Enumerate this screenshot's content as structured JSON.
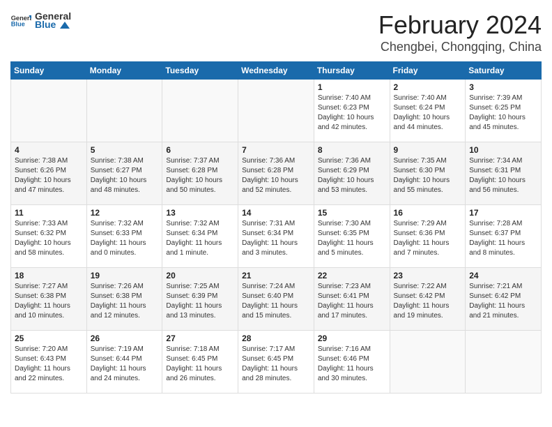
{
  "logo": {
    "general": "General",
    "blue": "Blue"
  },
  "title": "February 2024",
  "location": "Chengbei, Chongqing, China",
  "days_of_week": [
    "Sunday",
    "Monday",
    "Tuesday",
    "Wednesday",
    "Thursday",
    "Friday",
    "Saturday"
  ],
  "weeks": [
    [
      {
        "day": "",
        "info": ""
      },
      {
        "day": "",
        "info": ""
      },
      {
        "day": "",
        "info": ""
      },
      {
        "day": "",
        "info": ""
      },
      {
        "day": "1",
        "info": "Sunrise: 7:40 AM\nSunset: 6:23 PM\nDaylight: 10 hours and 42 minutes."
      },
      {
        "day": "2",
        "info": "Sunrise: 7:40 AM\nSunset: 6:24 PM\nDaylight: 10 hours and 44 minutes."
      },
      {
        "day": "3",
        "info": "Sunrise: 7:39 AM\nSunset: 6:25 PM\nDaylight: 10 hours and 45 minutes."
      }
    ],
    [
      {
        "day": "4",
        "info": "Sunrise: 7:38 AM\nSunset: 6:26 PM\nDaylight: 10 hours and 47 minutes."
      },
      {
        "day": "5",
        "info": "Sunrise: 7:38 AM\nSunset: 6:27 PM\nDaylight: 10 hours and 48 minutes."
      },
      {
        "day": "6",
        "info": "Sunrise: 7:37 AM\nSunset: 6:28 PM\nDaylight: 10 hours and 50 minutes."
      },
      {
        "day": "7",
        "info": "Sunrise: 7:36 AM\nSunset: 6:28 PM\nDaylight: 10 hours and 52 minutes."
      },
      {
        "day": "8",
        "info": "Sunrise: 7:36 AM\nSunset: 6:29 PM\nDaylight: 10 hours and 53 minutes."
      },
      {
        "day": "9",
        "info": "Sunrise: 7:35 AM\nSunset: 6:30 PM\nDaylight: 10 hours and 55 minutes."
      },
      {
        "day": "10",
        "info": "Sunrise: 7:34 AM\nSunset: 6:31 PM\nDaylight: 10 hours and 56 minutes."
      }
    ],
    [
      {
        "day": "11",
        "info": "Sunrise: 7:33 AM\nSunset: 6:32 PM\nDaylight: 10 hours and 58 minutes."
      },
      {
        "day": "12",
        "info": "Sunrise: 7:32 AM\nSunset: 6:33 PM\nDaylight: 11 hours and 0 minutes."
      },
      {
        "day": "13",
        "info": "Sunrise: 7:32 AM\nSunset: 6:34 PM\nDaylight: 11 hours and 1 minute."
      },
      {
        "day": "14",
        "info": "Sunrise: 7:31 AM\nSunset: 6:34 PM\nDaylight: 11 hours and 3 minutes."
      },
      {
        "day": "15",
        "info": "Sunrise: 7:30 AM\nSunset: 6:35 PM\nDaylight: 11 hours and 5 minutes."
      },
      {
        "day": "16",
        "info": "Sunrise: 7:29 AM\nSunset: 6:36 PM\nDaylight: 11 hours and 7 minutes."
      },
      {
        "day": "17",
        "info": "Sunrise: 7:28 AM\nSunset: 6:37 PM\nDaylight: 11 hours and 8 minutes."
      }
    ],
    [
      {
        "day": "18",
        "info": "Sunrise: 7:27 AM\nSunset: 6:38 PM\nDaylight: 11 hours and 10 minutes."
      },
      {
        "day": "19",
        "info": "Sunrise: 7:26 AM\nSunset: 6:38 PM\nDaylight: 11 hours and 12 minutes."
      },
      {
        "day": "20",
        "info": "Sunrise: 7:25 AM\nSunset: 6:39 PM\nDaylight: 11 hours and 13 minutes."
      },
      {
        "day": "21",
        "info": "Sunrise: 7:24 AM\nSunset: 6:40 PM\nDaylight: 11 hours and 15 minutes."
      },
      {
        "day": "22",
        "info": "Sunrise: 7:23 AM\nSunset: 6:41 PM\nDaylight: 11 hours and 17 minutes."
      },
      {
        "day": "23",
        "info": "Sunrise: 7:22 AM\nSunset: 6:42 PM\nDaylight: 11 hours and 19 minutes."
      },
      {
        "day": "24",
        "info": "Sunrise: 7:21 AM\nSunset: 6:42 PM\nDaylight: 11 hours and 21 minutes."
      }
    ],
    [
      {
        "day": "25",
        "info": "Sunrise: 7:20 AM\nSunset: 6:43 PM\nDaylight: 11 hours and 22 minutes."
      },
      {
        "day": "26",
        "info": "Sunrise: 7:19 AM\nSunset: 6:44 PM\nDaylight: 11 hours and 24 minutes."
      },
      {
        "day": "27",
        "info": "Sunrise: 7:18 AM\nSunset: 6:45 PM\nDaylight: 11 hours and 26 minutes."
      },
      {
        "day": "28",
        "info": "Sunrise: 7:17 AM\nSunset: 6:45 PM\nDaylight: 11 hours and 28 minutes."
      },
      {
        "day": "29",
        "info": "Sunrise: 7:16 AM\nSunset: 6:46 PM\nDaylight: 11 hours and 30 minutes."
      },
      {
        "day": "",
        "info": ""
      },
      {
        "day": "",
        "info": ""
      }
    ]
  ]
}
